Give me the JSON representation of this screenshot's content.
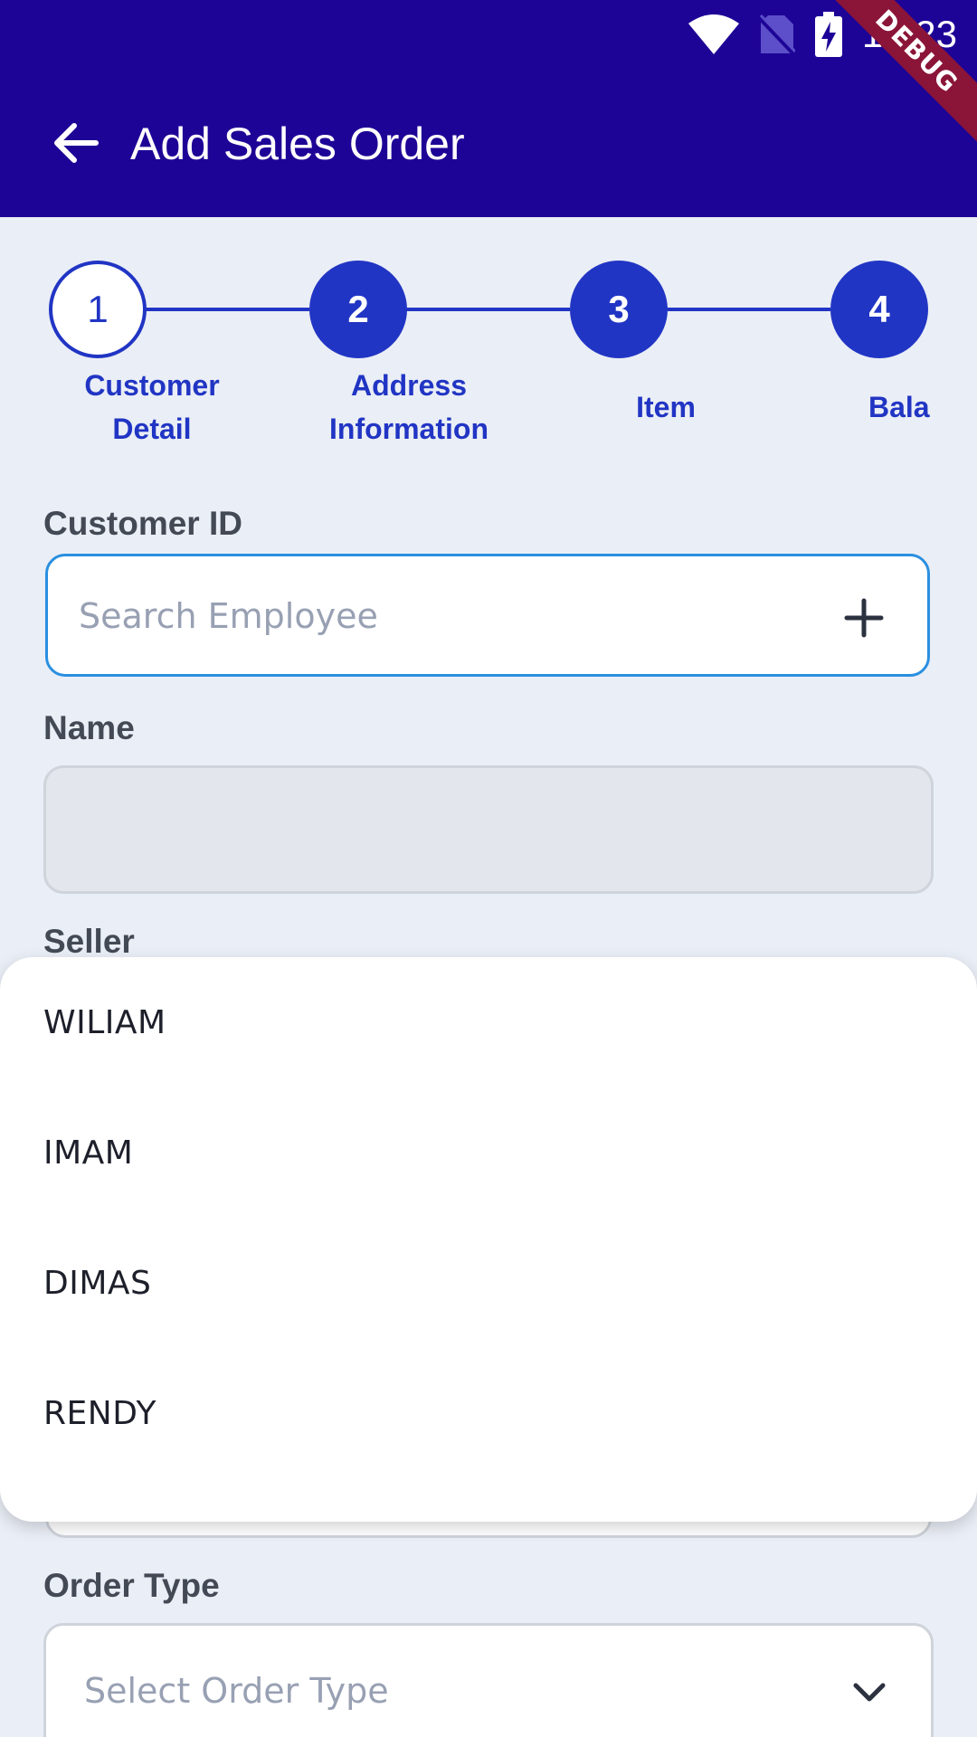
{
  "status_bar": {
    "time": "10:23",
    "debug_badge": "DEBUG"
  },
  "app_bar": {
    "title": "Add Sales Order"
  },
  "stepper": {
    "steps": [
      {
        "number": "1",
        "label_line1": "Customer",
        "label_line2": "Detail"
      },
      {
        "number": "2",
        "label_line1": "Address",
        "label_line2": "Information"
      },
      {
        "number": "3",
        "label_line1": "Item",
        "label_line2": ""
      },
      {
        "number": "4",
        "label_line1": "Bala",
        "label_line2": ""
      }
    ],
    "active_step": 1
  },
  "form": {
    "customer_id": {
      "label": "Customer ID",
      "placeholder": "Search Employee",
      "value": ""
    },
    "name": {
      "label": "Name",
      "value": ""
    },
    "seller": {
      "label": "Seller"
    },
    "order_type": {
      "label": "Order Type",
      "placeholder": "Select Order Type"
    }
  },
  "seller_dropdown": {
    "options": [
      "WILIAM",
      "IMAM",
      "DIMAS",
      "RENDY"
    ]
  },
  "colors": {
    "app_bar": "#1e0496",
    "accent": "#2135c4",
    "focus_border": "#2a8fe0",
    "background": "#eaeef6",
    "debug_ribbon": "#8a1538"
  },
  "icons": {
    "back": "arrow-left-icon",
    "add": "plus-icon",
    "dropdown": "chevron-down-icon",
    "wifi": "wifi-icon",
    "sim": "no-sim-icon",
    "battery": "battery-charging-icon"
  }
}
